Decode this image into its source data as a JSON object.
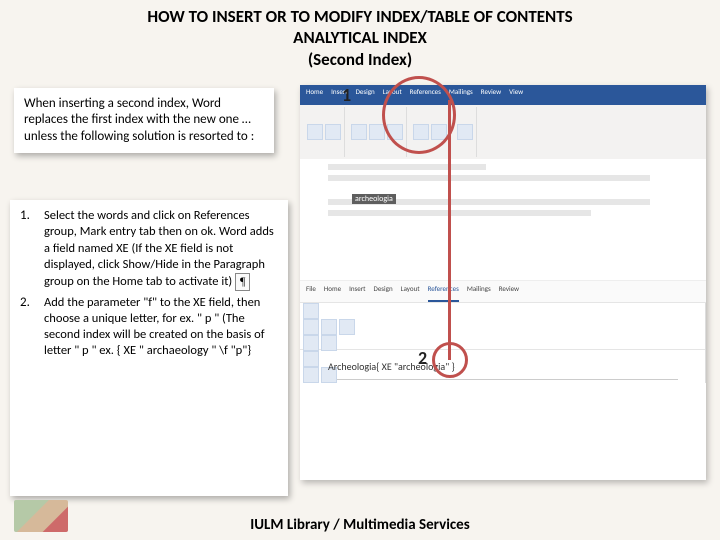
{
  "title": {
    "line1": "HOW TO INSERT OR TO MODIFY INDEX/TABLE OF CONTENTS",
    "line2": "ANALYTICAL  INDEX",
    "line3": "(Second Index)"
  },
  "intro": "When inserting a second index, Word replaces the first index with the new one … unless the following solution is resorted to   :",
  "steps": {
    "n1": "1.",
    "t1": "Select the words and click on References group, Mark entry tab then on ok.  Word adds a field named XE (If the XE field is not displayed, click Show/Hide in the Paragraph group on the Home tab to activate it)",
    "n2": "2.",
    "t2": "Add the parameter \"f\" to the XE field, then choose a unique letter, for ex. \" p \" (The second index will be created on the basis of letter \" p \" ex. { XE \" archaeology \" \\f \"p\"}"
  },
  "showhide": "¶",
  "callouts": {
    "c1": "1",
    "c2": "2"
  },
  "word": {
    "tabs": [
      "Home",
      "Insert",
      "Design",
      "Layout",
      "References",
      "Mailings",
      "Review",
      "View"
    ],
    "hltext": "archeologia",
    "tabs2": [
      "File",
      "Home",
      "Insert",
      "Design",
      "Layout",
      "References",
      "Mailings",
      "Review"
    ],
    "xe": "Archeologia{ XE \"archeologia\" }"
  },
  "footer": "IULM Library / Multimedia Services"
}
